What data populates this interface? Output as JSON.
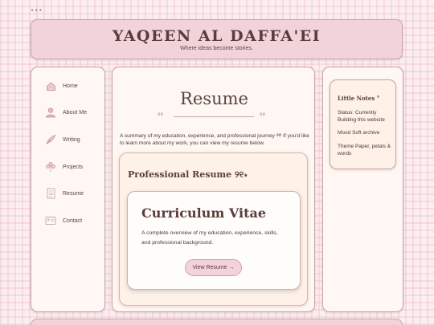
{
  "header": {
    "menu_dots": "•••",
    "site_title": "YAQEEN AL DAFFA'EI",
    "tagline": "Where ideas become stories."
  },
  "sidebar": {
    "items": [
      {
        "label": "Home",
        "icon": "house-icon"
      },
      {
        "label": "About Me",
        "icon": "person-icon"
      },
      {
        "label": "Writing",
        "icon": "quill-icon"
      },
      {
        "label": "Projects",
        "icon": "flower-icon"
      },
      {
        "label": "Resume",
        "icon": "document-icon"
      },
      {
        "label": "Contact",
        "icon": "id-card-icon"
      }
    ]
  },
  "main": {
    "title": "Resume",
    "divider_glyph": "୨୧",
    "intro": "A summary of my education, experience, and professional journey ୨୧ If you'd like to learn more about my work, you can view my resume below.",
    "section_heading": "Professional Resume ୨୧⋆",
    "card": {
      "title": "Curriculum Vitae",
      "description": "A complete overview of my education, experience, skills, and professional background.",
      "button_label": "View Resume →"
    }
  },
  "notes": {
    "title": "Little Notes °",
    "items": [
      "Status: Currently Building this website",
      "Mood Soft archive",
      "Theme Paper, petals & words"
    ]
  },
  "colors": {
    "accent": "#f3d3da",
    "border": "#c9a6a6",
    "text": "#5a3d3a",
    "panel": "#fff7f3"
  }
}
